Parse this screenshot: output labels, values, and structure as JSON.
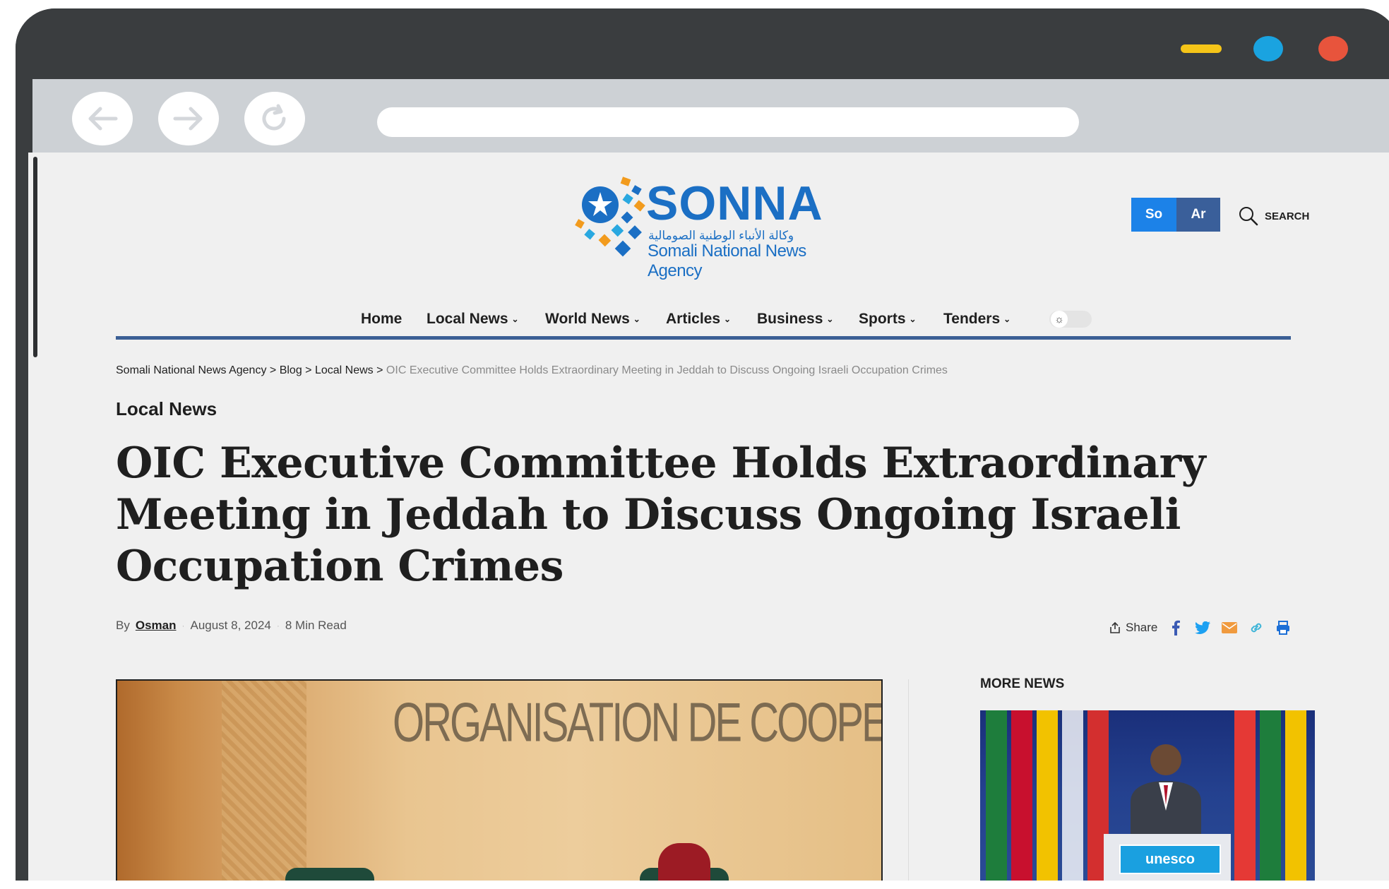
{
  "colors": {
    "window_min": "#f5c518",
    "window_max": "#1aa3e0",
    "window_close": "#e8543c",
    "nav_line": "#3b5f95",
    "lang_so": "#1c82e8",
    "lang_ar": "#3a5f9a"
  },
  "site": {
    "logo_name": "SONNA",
    "logo_arabic": "وكالة الأنباء الوطنية الصومالية",
    "logo_subtitle": "Somali National News Agency"
  },
  "header": {
    "lang_so": "So",
    "lang_ar": "Ar",
    "search_label": "SEARCH"
  },
  "nav": {
    "items": [
      {
        "label": "Home",
        "has_dropdown": false
      },
      {
        "label": "Local News",
        "has_dropdown": true
      },
      {
        "label": "World News",
        "has_dropdown": true
      },
      {
        "label": "Articles",
        "has_dropdown": true
      },
      {
        "label": "Business",
        "has_dropdown": true
      },
      {
        "label": "Sports",
        "has_dropdown": true
      },
      {
        "label": "Tenders",
        "has_dropdown": true
      }
    ],
    "theme_icon": "sun-icon"
  },
  "breadcrumb": {
    "items": [
      "Somali National News Agency",
      "Blog",
      "Local News"
    ],
    "separator": ">",
    "current": "OIC Executive Committee Holds Extraordinary Meeting in Jeddah to Discuss Ongoing Israeli Occupation Crimes"
  },
  "article": {
    "category": "Local News",
    "title": "OIC Executive Committee Holds Extraordinary Meeting in Jeddah to Discuss Ongoing Israeli Occupation Crimes",
    "by_label": "By",
    "author": "Osman",
    "date": "August 8, 2024",
    "read_time": "8 Min Read",
    "hero_banner_text": "ORGANISATION DE COOPERATION ISLAMIQ"
  },
  "share": {
    "label": "Share",
    "icons": [
      "facebook-icon",
      "twitter-icon",
      "email-icon",
      "link-icon",
      "print-icon"
    ]
  },
  "sidebar": {
    "title": "MORE NEWS",
    "image_badge": "unesco"
  }
}
